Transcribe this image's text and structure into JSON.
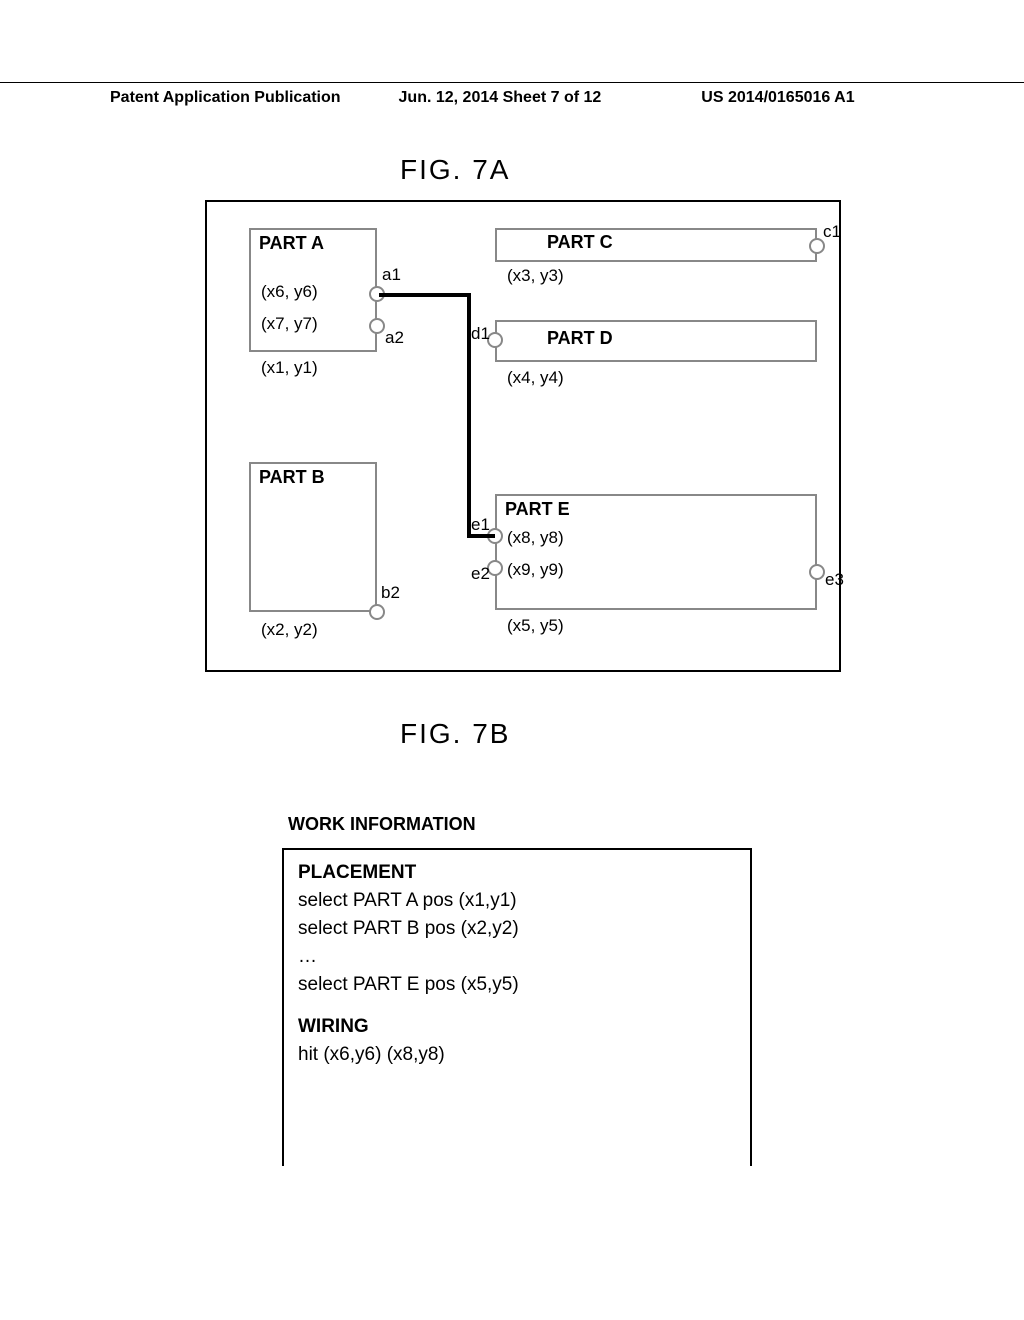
{
  "header": {
    "left": "Patent Application Publication",
    "mid": "Jun. 12, 2014  Sheet 7 of 12",
    "right": "US 2014/0165016 A1"
  },
  "figA_label": "FIG. 7A",
  "figB_label": "FIG. 7B",
  "parts": {
    "a": {
      "label": "PART A",
      "coord": "(x1, y1)"
    },
    "b": {
      "label": "PART B",
      "coord": "(x2, y2)"
    },
    "c": {
      "label": "PART C",
      "coord": "(x3, y3)"
    },
    "d": {
      "label": "PART D",
      "coord": "(x4, y4)"
    },
    "e": {
      "label": "PART E",
      "coord": "(x5, y5)"
    }
  },
  "pins": {
    "a1": {
      "label": "a1",
      "coord": "(x6, y6)"
    },
    "a2": {
      "label": "a2",
      "coord": "(x7, y7)"
    },
    "b2": {
      "label": "b2"
    },
    "c1": {
      "label": "c1"
    },
    "d1": {
      "label": "d1"
    },
    "e1": {
      "label": "e1",
      "coord": "(x8, y8)"
    },
    "e2": {
      "label": "e2",
      "coord": "(x9, y9)"
    },
    "e3": {
      "label": "e3"
    }
  },
  "work_info": {
    "title": "WORK INFORMATION",
    "placement_head": "PLACEMENT",
    "placement_lines": [
      "select PART A  pos (x1,y1)",
      "select PART B  pos (x2,y2)",
      "…",
      "select PART E  pos (x5,y5)"
    ],
    "wiring_head": "WIRING",
    "wiring_lines": [
      "hit (x6,y6) (x8,y8)"
    ]
  }
}
